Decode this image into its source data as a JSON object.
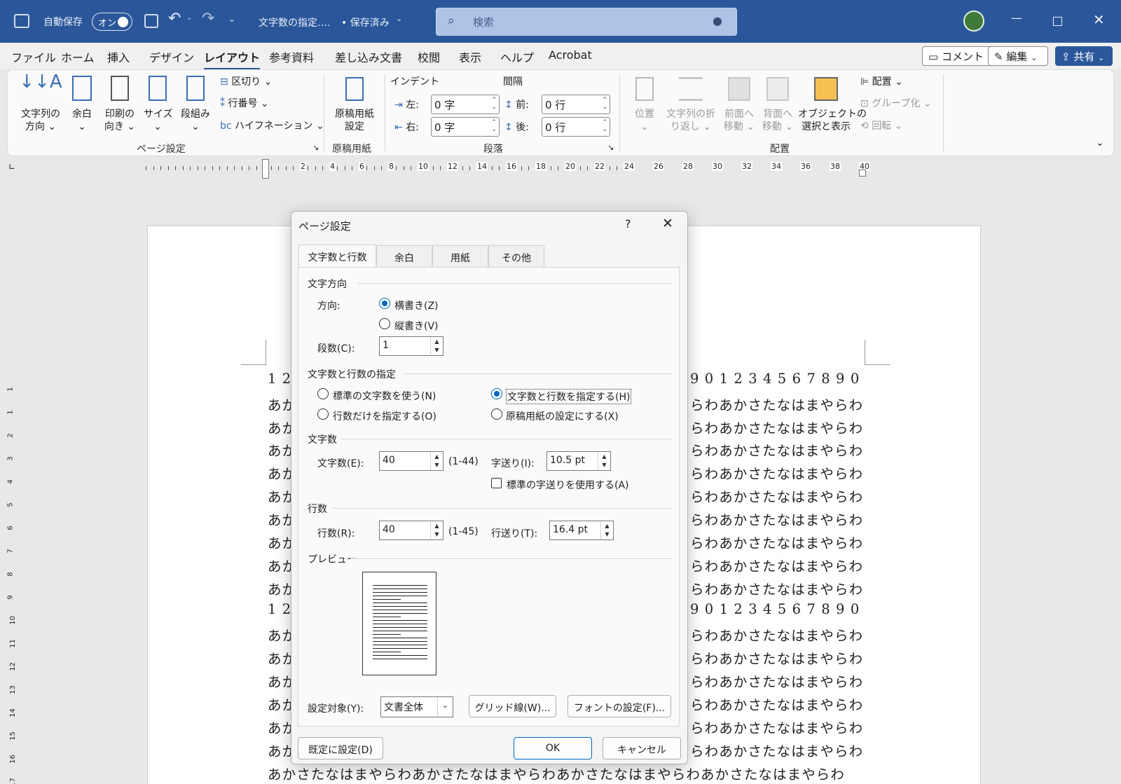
{
  "titlebar": {
    "autosave_label": "自動保存",
    "autosave_toggle": "オン",
    "doc_title": "文字数の指定.…",
    "save_status": "• 保存済み",
    "search_placeholder": "検索"
  },
  "tabs": [
    "ファイル",
    "ホーム",
    "挿入",
    "デザイン",
    "レイアウト",
    "参考資料",
    "差し込み文書",
    "校閲",
    "表示",
    "ヘルプ",
    "Acrobat"
  ],
  "active_tab": "レイアウト",
  "actions": {
    "comment": "コメント",
    "edit": "編集",
    "share": "共有"
  },
  "ribbon": {
    "page_setup": {
      "text_direction": [
        "文字列の",
        "方向"
      ],
      "margins": "余白",
      "orientation": [
        "印刷の",
        "向き"
      ],
      "size": "サイズ",
      "columns": "段組み",
      "breaks": "区切り",
      "line_numbers": "行番号",
      "hyphenation": "ハイフネーション",
      "group": "ページ設定"
    },
    "genko": {
      "button": [
        "原稿用紙",
        "設定"
      ],
      "group": "原稿用紙"
    },
    "paragraph": {
      "indent_label": "インデント",
      "spacing_label": "間隔",
      "left_label": "左:",
      "left_value": "0 字",
      "right_label": "右:",
      "right_value": "0 字",
      "before_label": "前:",
      "before_value": "0 行",
      "after_label": "後:",
      "after_value": "0 行",
      "group": "段落"
    },
    "arrange": {
      "position": "位置",
      "wrap": [
        "文字列の折",
        "り返し"
      ],
      "forward": [
        "前面へ",
        "移動"
      ],
      "backward": [
        "背面へ",
        "移動"
      ],
      "selection_pane": [
        "オブジェクトの",
        "選択と表示"
      ],
      "align": "配置",
      "group_btn": "グループ化",
      "rotate": "回転",
      "group": "配置"
    }
  },
  "ruler_numbers": [
    "2",
    "4",
    "6",
    "8",
    "10",
    "12",
    "14",
    "16",
    "18",
    "20",
    "22",
    "24",
    "26",
    "28",
    "30",
    "32",
    "34",
    "36",
    "38",
    "40"
  ],
  "vruler_numbers": [
    "1",
    "1",
    "2",
    "3",
    "4",
    "5",
    "6",
    "7",
    "8",
    "9",
    "10",
    "11",
    "12",
    "13",
    "14",
    "15",
    "16",
    "17",
    "18"
  ],
  "document": {
    "line_left_kana": "あか",
    "line_left_num": "1 2",
    "line_right_kana": "らわあかさたなはまやらわ",
    "line_right_num": "9 0 1 2 3 4 5 6 7 8 9 0",
    "last_line": "あかさたなはまやらわあかさたなはまやらわあかさたなはまやらわあかさたなはまやらわ"
  },
  "dialog": {
    "title": "ページ設定",
    "help": "?",
    "tabs": [
      "文字数と行数",
      "余白",
      "用紙",
      "その他"
    ],
    "sec_direction": "文字方向",
    "direction_label": "方向:",
    "horizontal": "横書き(Z)",
    "vertical": "縦書き(V)",
    "columns_label": "段数(C):",
    "columns_value": "1",
    "sec_grid": "文字数と行数の指定",
    "opt_standard": "標準の文字数を使う(N)",
    "opt_lines_only": "行数だけを指定する(O)",
    "opt_chars_lines": "文字数と行数を指定する(H)",
    "opt_genko": "原稿用紙の設定にする(X)",
    "sec_chars": "文字数",
    "chars_label": "文字数(E):",
    "chars_value": "40",
    "chars_range": "(1-44)",
    "pitch_label": "字送り(I):",
    "pitch_value": "10.5 pt",
    "std_pitch": "標準の字送りを使用する(A)",
    "sec_lines": "行数",
    "lines_label": "行数(R):",
    "lines_value": "40",
    "lines_range": "(1-45)",
    "line_pitch_label": "行送り(T):",
    "line_pitch_value": "16.4 pt",
    "sec_preview": "プレビュー",
    "apply_label": "設定対象(Y):",
    "apply_value": "文書全体",
    "grid_btn": "グリッド線(W)...",
    "font_btn": "フォントの設定(F)...",
    "default_btn": "既定に設定(D)",
    "ok": "OK",
    "cancel": "キャンセル"
  },
  "colors": {
    "title_bar": "#2b579a",
    "accent": "#0067c0"
  }
}
